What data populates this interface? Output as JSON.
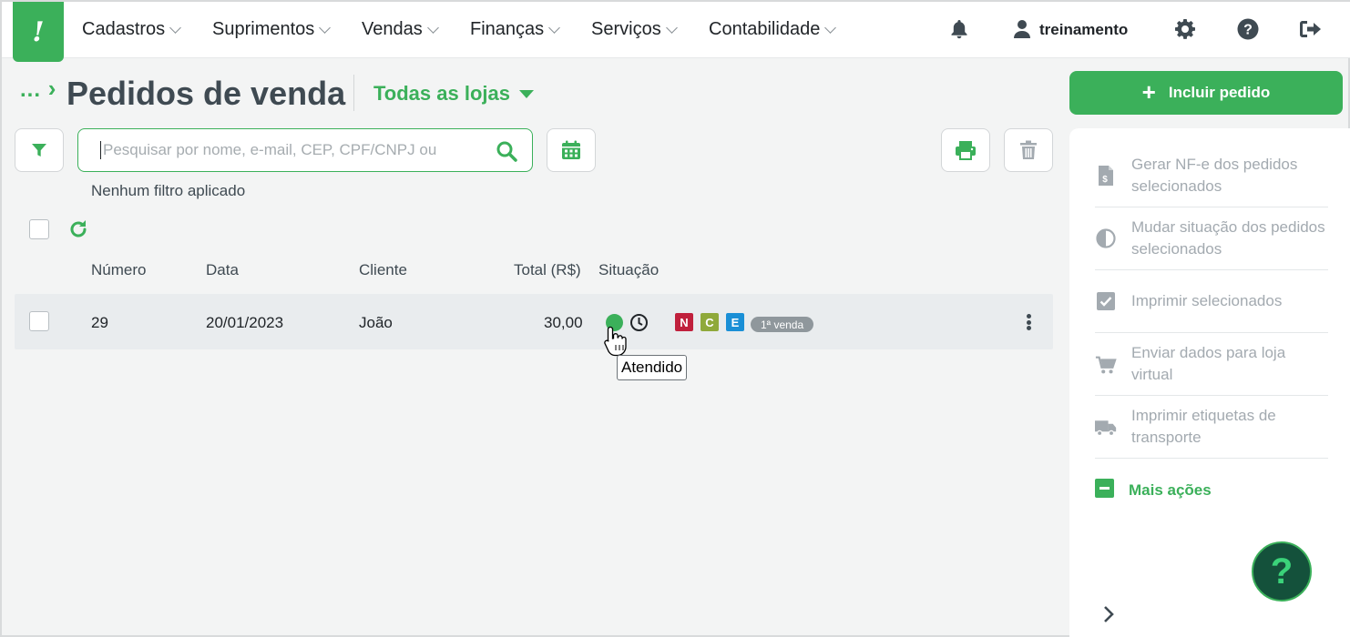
{
  "nav": {
    "logo_text": "!",
    "items": [
      {
        "label": "Cadastros"
      },
      {
        "label": "Suprimentos"
      },
      {
        "label": "Vendas"
      },
      {
        "label": "Finanças"
      },
      {
        "label": "Serviços"
      },
      {
        "label": "Contabilidade"
      }
    ],
    "user_name": "treinamento"
  },
  "header": {
    "crumb": "...",
    "title": "Pedidos de venda",
    "store_filter": "Todas as lojas"
  },
  "search": {
    "placeholder": "Pesquisar por nome, e-mail, CEP, CPF/CNPJ ou"
  },
  "filter_status": "Nenhum filtro aplicado",
  "table": {
    "columns": [
      "Número",
      "Data",
      "Cliente",
      "Total (R$)",
      "Situação"
    ],
    "rows": [
      {
        "numero": "29",
        "data": "20/01/2023",
        "cliente": "João",
        "total": "30,00",
        "status_color": "#3bb05a",
        "tags": [
          {
            "letter": "N",
            "color": "#c0203c"
          },
          {
            "letter": "C",
            "color": "#8fa93a"
          },
          {
            "letter": "E",
            "color": "#1a8fd6"
          }
        ],
        "badge": "1ª venda"
      }
    ]
  },
  "tooltip": "Atendido",
  "sidebar": {
    "add_button": "Incluir pedido",
    "actions": [
      {
        "label": "Gerar NF-e dos pedidos selecionados",
        "icon": "invoice-icon"
      },
      {
        "label": "Mudar situação dos pedidos selecionados",
        "icon": "half-circle-icon"
      },
      {
        "label": "Imprimir selecionados",
        "icon": "checkbox-icon"
      },
      {
        "label": "Enviar dados para loja virtual",
        "icon": "cart-icon"
      },
      {
        "label": "Imprimir etiquetas de transporte",
        "icon": "truck-icon"
      }
    ],
    "more_actions": "Mais ações",
    "help_label": "?"
  },
  "colors": {
    "brand": "#3bb05a",
    "text_dark": "#3f4a52",
    "muted": "#a3aab0"
  }
}
